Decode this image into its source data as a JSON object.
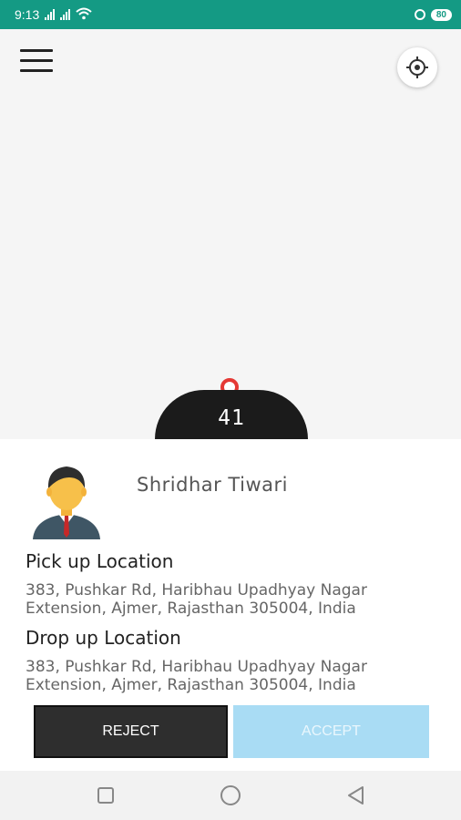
{
  "status_bar": {
    "time": "9:13",
    "battery": "80",
    "icons": [
      "signal-icon",
      "signal-icon",
      "wifi-icon",
      "circle-status-icon",
      "battery-icon"
    ]
  },
  "map": {
    "menu_icon": "hamburger-icon",
    "locate_icon": "gps-locate-icon",
    "pin_icon": "map-pin-icon",
    "eta_count": "41"
  },
  "ride_request": {
    "rider_name": "Shridhar Tiwari",
    "pickup_label": "Pick up Location",
    "pickup_line1": "383, Pushkar Rd, Haribhau Upadhyay Nagar",
    "pickup_line2": "Extension, Ajmer, Rajasthan 305004, India",
    "drop_label": "Drop up Location",
    "drop_line1": "383, Pushkar Rd, Haribhau Upadhyay Nagar",
    "drop_line2": "Extension, Ajmer, Rajasthan 305004, India",
    "reject_label": "REJECT",
    "accept_label": "ACCEPT"
  },
  "nav_bar": {
    "recents_icon": "square-icon",
    "home_icon": "circle-icon",
    "back_icon": "triangle-back-icon"
  },
  "colors": {
    "status_bar": "#149a84",
    "reject_button": "#2e2e2e",
    "accept_button": "#a9dcf4",
    "pin": "#e53935",
    "dome": "#1b1b1b"
  }
}
